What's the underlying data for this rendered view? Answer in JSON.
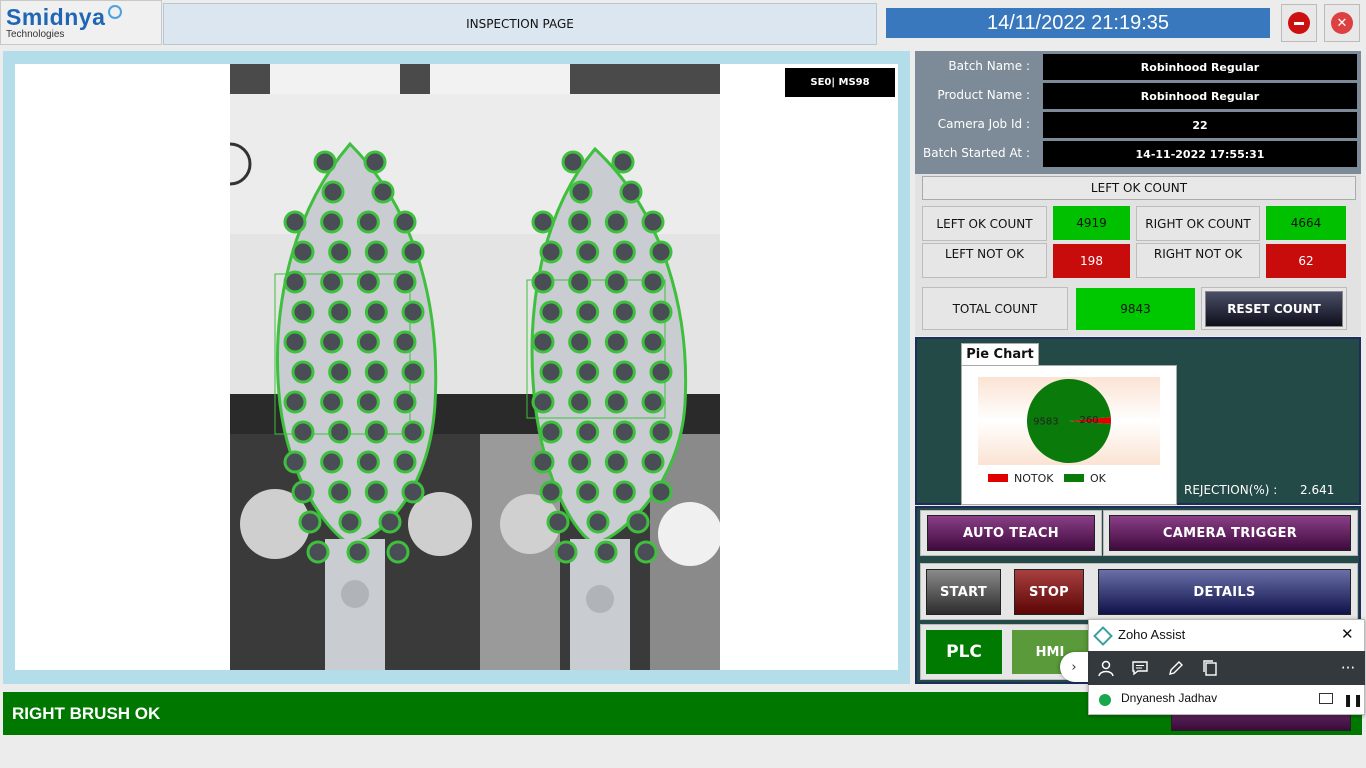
{
  "header": {
    "logo_main": "Smidnya",
    "logo_sub": "Technologies",
    "title": "INSPECTION PAGE",
    "datetime": "14/11/2022 21:19:35",
    "minimize_icon": "minus-circle-icon",
    "close_icon": "close-circle-icon"
  },
  "camera": {
    "label": "SE0| MS98"
  },
  "batch": {
    "batch_name_label": "Batch Name  :",
    "batch_name": "Robinhood Regular",
    "product_name_label": "Product Name :",
    "product_name": "Robinhood Regular",
    "camera_job_label": "Camera Job Id :",
    "camera_job_id": "22",
    "started_label": "Batch Started At :",
    "started_at": "14-11-2022 17:55:31"
  },
  "counts": {
    "header": "LEFT OK COUNT",
    "left_ok_label": "LEFT OK COUNT",
    "left_ok": "4919",
    "right_ok_label": "RIGHT OK COUNT",
    "right_ok": "4664",
    "left_not_ok_label": "LEFT NOT OK",
    "left_not_ok": "198",
    "right_not_ok_label": "RIGHT NOT OK",
    "right_not_ok": "62",
    "total_label": "TOTAL COUNT",
    "total": "9843",
    "reset_label": "RESET COUNT"
  },
  "chart_tab": "Pie Chart",
  "chart_data": {
    "type": "pie",
    "categories": [
      "NOTOK",
      "OK"
    ],
    "values": [
      260,
      9583
    ],
    "colors": [
      "#e00000",
      "#0a7a0a"
    ],
    "legend": [
      "NOTOK",
      "OK"
    ],
    "legend_position": "bottom"
  },
  "rejection": {
    "label": "REJECTION(%)   :",
    "value": "2.641"
  },
  "actions": {
    "auto_teach": "AUTO TEACH",
    "camera_trigger": "CAMERA TRIGGER",
    "start": "START",
    "stop": "STOP",
    "details": "DETAILS",
    "plc": "PLC",
    "hmi": "HMI"
  },
  "status": {
    "text": "RIGHT BRUSH OK"
  },
  "zoho": {
    "title": "Zoho Assist",
    "user": "Dnyanesh Jadhav",
    "icons": [
      "user-icon",
      "chat-icon",
      "annotate-icon",
      "files-icon",
      "more-icon"
    ]
  }
}
